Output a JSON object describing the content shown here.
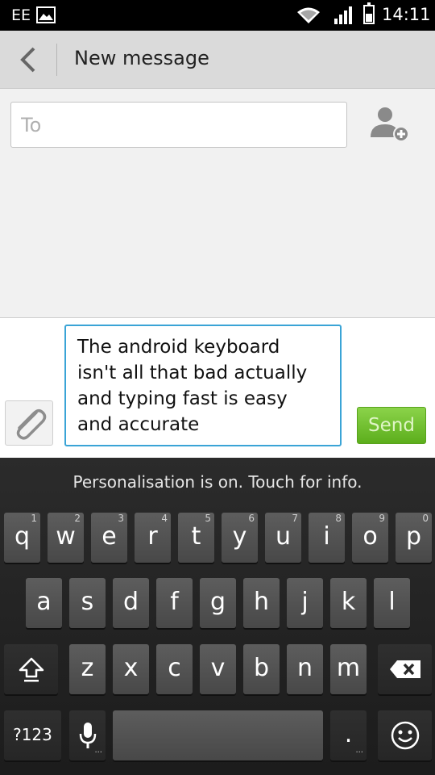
{
  "status_bar": {
    "carrier": "EE",
    "time": "14:11",
    "icons": [
      "image-notification-icon",
      "wifi-icon",
      "signal-icon",
      "battery-icon"
    ]
  },
  "action_bar": {
    "title": "New message",
    "back_icon": "chevron-left-icon"
  },
  "recipient": {
    "placeholder": "To",
    "value": "",
    "add_contact_icon": "add-contact-icon"
  },
  "compose": {
    "message_lines": [
      "The android keyboard",
      "isn't all that bad actually",
      "and typing fast is easy",
      "and accurate"
    ],
    "send_label": "Send",
    "attach_icon": "paperclip-icon"
  },
  "keyboard": {
    "banner": "Personalisation is on. Touch for info.",
    "row1": [
      {
        "label": "q",
        "hint": "1"
      },
      {
        "label": "w",
        "hint": "2"
      },
      {
        "label": "e",
        "hint": "3"
      },
      {
        "label": "r",
        "hint": "4"
      },
      {
        "label": "t",
        "hint": "5"
      },
      {
        "label": "y",
        "hint": "6"
      },
      {
        "label": "u",
        "hint": "7"
      },
      {
        "label": "i",
        "hint": "8"
      },
      {
        "label": "o",
        "hint": "9"
      },
      {
        "label": "p",
        "hint": "0"
      }
    ],
    "row2": [
      "a",
      "s",
      "d",
      "f",
      "g",
      "h",
      "j",
      "k",
      "l"
    ],
    "row3": [
      "z",
      "x",
      "c",
      "v",
      "b",
      "n",
      "m"
    ],
    "symbols_label": "?123",
    "period_label": ".",
    "function_icons": [
      "shift-icon",
      "backspace-icon",
      "microphone-icon",
      "emoji-icon"
    ]
  },
  "colors": {
    "accent": "#3aa4d6",
    "send_button": "#6cbf2b",
    "keyboard_bg": "#222222",
    "key_bg": "#525252"
  }
}
